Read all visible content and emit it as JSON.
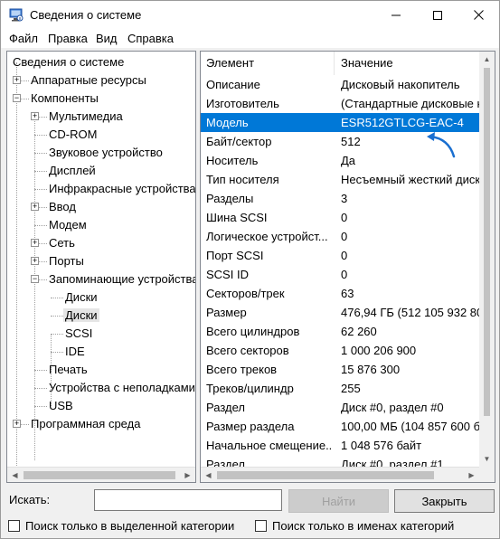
{
  "window": {
    "title": "Сведения о системе"
  },
  "menu": {
    "file": "Файл",
    "edit": "Правка",
    "view": "Вид",
    "help": "Справка"
  },
  "tree": {
    "items": [
      {
        "label": "Сведения о системе",
        "level": 0,
        "expander": "none"
      },
      {
        "label": "Аппаратные ресурсы",
        "level": 1,
        "expander": "plus"
      },
      {
        "label": "Компоненты",
        "level": 1,
        "expander": "minus"
      },
      {
        "label": "Мультимедиа",
        "level": 2,
        "expander": "plus"
      },
      {
        "label": "CD-ROM",
        "level": 2,
        "expander": "none"
      },
      {
        "label": "Звуковое устройство",
        "level": 2,
        "expander": "none"
      },
      {
        "label": "Дисплей",
        "level": 2,
        "expander": "none"
      },
      {
        "label": "Инфракрасные устройства",
        "level": 2,
        "expander": "none"
      },
      {
        "label": "Ввод",
        "level": 2,
        "expander": "plus"
      },
      {
        "label": "Модем",
        "level": 2,
        "expander": "none"
      },
      {
        "label": "Сеть",
        "level": 2,
        "expander": "plus"
      },
      {
        "label": "Порты",
        "level": 2,
        "expander": "plus"
      },
      {
        "label": "Запоминающие устройства",
        "level": 2,
        "expander": "minus"
      },
      {
        "label": "Диски",
        "level": 3,
        "expander": "none"
      },
      {
        "label": "Диски",
        "level": 3,
        "expander": "none",
        "selected": true
      },
      {
        "label": "SCSI",
        "level": 3,
        "expander": "none"
      },
      {
        "label": "IDE",
        "level": 3,
        "expander": "none"
      },
      {
        "label": "Печать",
        "level": 2,
        "expander": "none"
      },
      {
        "label": "Устройства с неполадками",
        "level": 2,
        "expander": "none"
      },
      {
        "label": "USB",
        "level": 2,
        "expander": "none"
      },
      {
        "label": "Программная среда",
        "level": 1,
        "expander": "plus"
      }
    ]
  },
  "details": {
    "columns": {
      "element": "Элемент",
      "value": "Значение"
    },
    "rows": [
      {
        "element": "Описание",
        "value": "Дисковый накопитель"
      },
      {
        "element": "Изготовитель",
        "value": "(Стандартные дисковые н"
      },
      {
        "element": "Модель",
        "value": "ESR512GTLCG-EAC-4",
        "selected": true
      },
      {
        "element": "Байт/сектор",
        "value": "512"
      },
      {
        "element": "Носитель",
        "value": "Да"
      },
      {
        "element": "Тип носителя",
        "value": "Несъемный жесткий диск"
      },
      {
        "element": "Разделы",
        "value": "3"
      },
      {
        "element": "Шина SCSI",
        "value": "0"
      },
      {
        "element": "Логическое устройст...",
        "value": "0"
      },
      {
        "element": "Порт SCSI",
        "value": "0"
      },
      {
        "element": "SCSI ID",
        "value": "0"
      },
      {
        "element": "Секторов/трек",
        "value": "63"
      },
      {
        "element": "Размер",
        "value": "476,94 ГБ (512 105 932 80"
      },
      {
        "element": "Всего цилиндров",
        "value": "62 260"
      },
      {
        "element": "Всего секторов",
        "value": "1 000 206 900"
      },
      {
        "element": "Всего треков",
        "value": "15 876 300"
      },
      {
        "element": "Треков/цилиндр",
        "value": "255"
      },
      {
        "element": "Раздел",
        "value": "Диск #0, раздел #0"
      },
      {
        "element": "Размер раздела",
        "value": "100,00 МБ (104 857 600 б"
      },
      {
        "element": "Начальное смещение...",
        "value": "1 048 576 байт"
      },
      {
        "element": "Раздел",
        "value": "Диск #0, раздел #1"
      }
    ]
  },
  "search": {
    "label": "Искать:",
    "value": "",
    "find_button": "Найти",
    "close_button": "Закрыть"
  },
  "checkboxes": {
    "selected_category": "Поиск только в выделенной категории",
    "category_names": "Поиск только в именах категорий"
  },
  "colors": {
    "selection": "#0078d7",
    "annotation_arrow": "#1a6fd0"
  }
}
